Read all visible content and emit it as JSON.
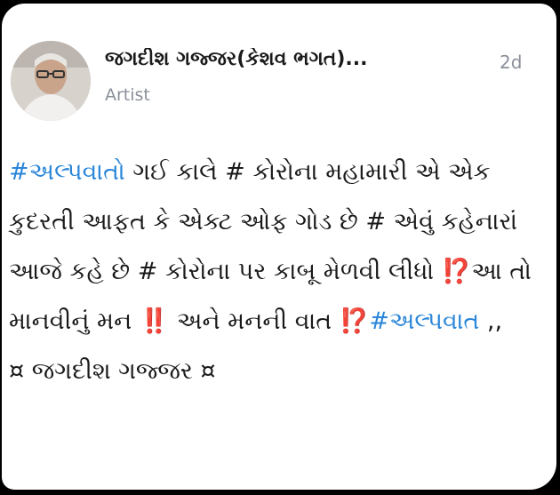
{
  "post": {
    "author": "જગદીશ ગજ્જર(કેશવ ભગત)...",
    "role": "Artist",
    "age": "2d",
    "hashtag1": "#અલ્પવાતો",
    "text1": " ગઈ કાલે # કોરોના મહામારી એ એક કુદરતી આફત કે એક્ટ ઓફ ગોડ છે # એવું કહેનારાં આજે કહે છે # કોરોના પર કાબૂ મેળવી લીધો ",
    "emoji1": "⁉️",
    "text2": "આ તો માનવીનું મન ",
    "emoji2": "‼️",
    "text3": " અને મનની વાત ",
    "emoji3": "⁉️",
    "hashtag2": "#અલ્પવાત",
    "text4": " ,,",
    "signature": "¤ જગદીશ ગજ્જર ¤"
  }
}
